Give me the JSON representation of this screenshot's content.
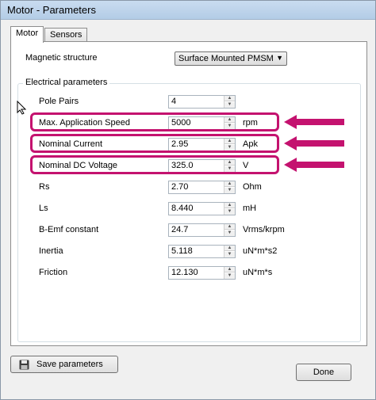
{
  "window": {
    "title": "Motor - Parameters"
  },
  "tabs": [
    {
      "label": "Motor",
      "active": true
    },
    {
      "label": "Sensors",
      "active": false
    }
  ],
  "magnetic": {
    "label": "Magnetic structure",
    "value": "Surface Mounted PMSM"
  },
  "electrical": {
    "title": "Electrical parameters",
    "params": [
      {
        "label": "Pole Pairs",
        "value": "4",
        "unit": "",
        "highlighted": false
      },
      {
        "label": "Max. Application Speed",
        "value": "5000",
        "unit": "rpm",
        "highlighted": true
      },
      {
        "label": "Nominal Current",
        "value": "2.95",
        "unit": "Apk",
        "highlighted": true
      },
      {
        "label": "Nominal DC Voltage",
        "value": "325.0",
        "unit": "V",
        "highlighted": true
      },
      {
        "label": "Rs",
        "value": "2.70",
        "unit": "Ohm",
        "highlighted": false
      },
      {
        "label": "Ls",
        "value": "8.440",
        "unit": "mH",
        "highlighted": false
      },
      {
        "label": "B-Emf constant",
        "value": "24.7",
        "unit": "Vrms/krpm",
        "highlighted": false
      },
      {
        "label": "Inertia",
        "value": "5.118",
        "unit": "uN*m*s2",
        "highlighted": false
      },
      {
        "label": "Friction",
        "value": "12.130",
        "unit": "uN*m*s",
        "highlighted": false
      }
    ]
  },
  "buttons": {
    "save": "Save parameters",
    "done": "Done"
  },
  "colors": {
    "highlight": "#c4126f",
    "titlebar": "#b9d1ea"
  }
}
